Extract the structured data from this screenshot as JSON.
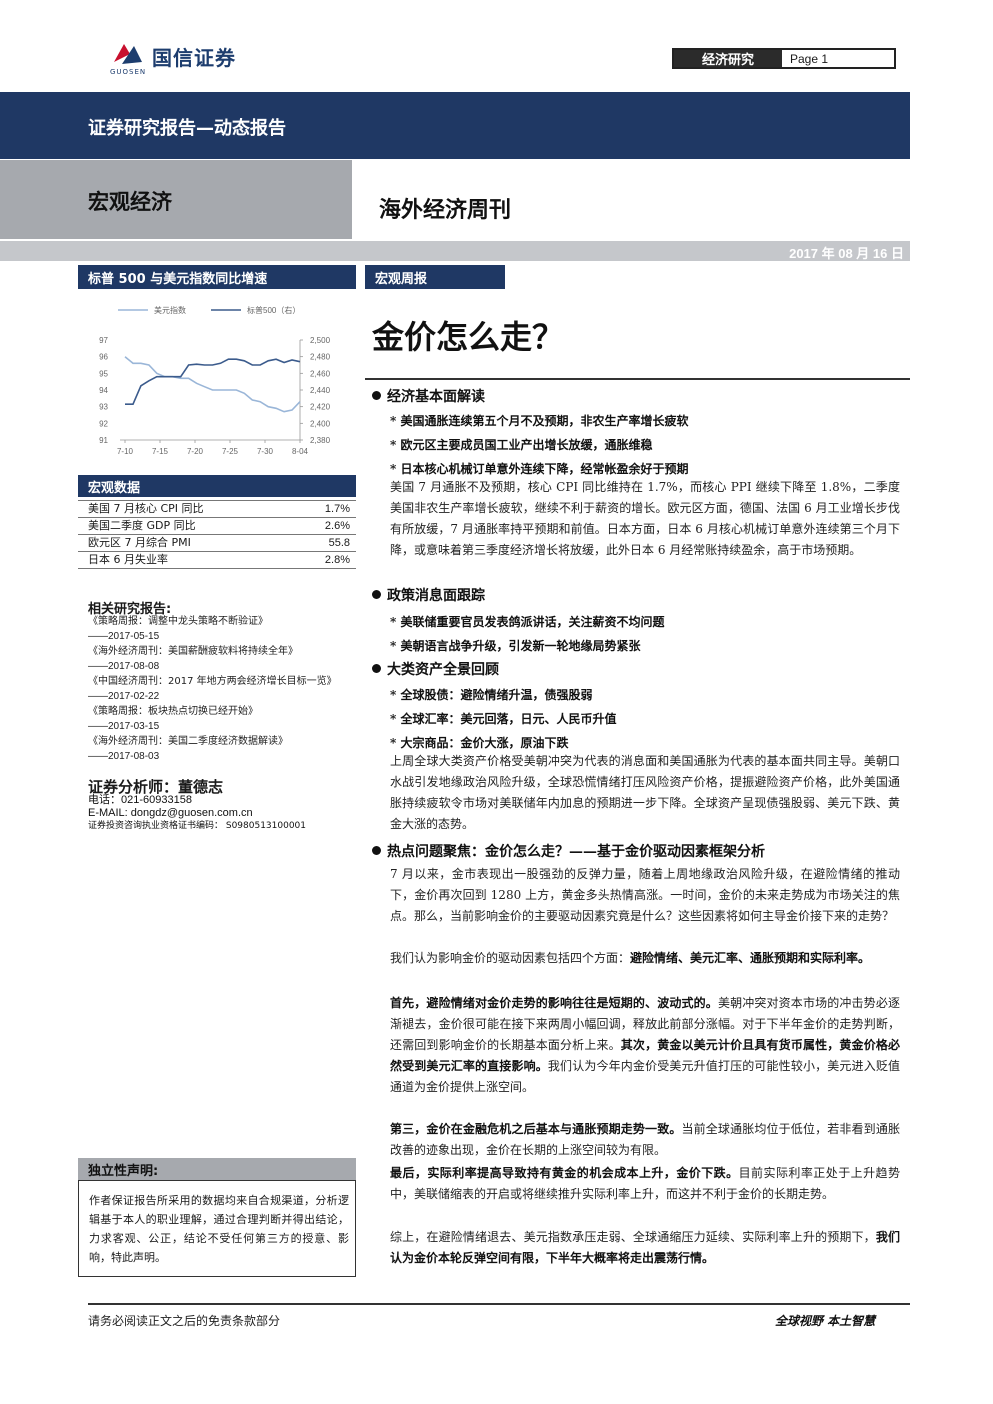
{
  "header": {
    "logo_text": "国信证券",
    "logo_sub": "GUOSEN",
    "tag": "经济研究",
    "page_label": "Page",
    "page_num": "1",
    "banner": "证券研究报告—动态报告",
    "category": "宏观经济",
    "periodical": "海外经济周刊",
    "date": "2017 年 08 月 16 日"
  },
  "sidebar": {
    "chart_title": "标普 500 与美元指数同比增速",
    "macro_title": "宏观数据",
    "macro_rows": [
      {
        "label": "美国 7 月核心 CPI 同比",
        "value": "1.7%"
      },
      {
        "label": "美国二季度 GDP 同比",
        "value": "2.6%"
      },
      {
        "label": "欧元区 7 月综合 PMI",
        "value": "55.8"
      },
      {
        "label": "日本 6 月失业率",
        "value": "2.8%"
      }
    ],
    "related_head": "相关研究报告:",
    "related": [
      {
        "title": "《策略周报：调整中龙头策略不断验证》",
        "date": "——2017-05-15"
      },
      {
        "title": "《海外经济周刊：美国薪酬疲软料将持续全年》",
        "date": "——2017-08-08"
      },
      {
        "title": "《中国经济周刊：2017 年地方两会经济增长目标一览》",
        "date": "——2017-02-22"
      },
      {
        "title": "《策略周报：板块热点切换已经开始》",
        "date": "——2017-03-15"
      },
      {
        "title": "《海外经济周刊：美国二季度经济数据解读》",
        "date": "——2017-08-03"
      }
    ],
    "analyst_head": "证券分析师：董德志",
    "phone": "电话：021-60933158",
    "email": "E-MAIL:    dongdz@guosen.com.cn",
    "license": "证券投资咨询执业资格证书编码：  S0980513100001",
    "indep_title": "独立性声明:",
    "indep_text": "作者保证报告所采用的数据均来自合规渠道，分析逻辑基于本人的职业理解，通过合理判断并得出结论，力求客观、公正，结论不受任何第三方的授意、影响，特此声明。"
  },
  "main": {
    "tag": "宏观周报",
    "title": "金价怎么走？",
    "sec1": "经济基本面解读",
    "sec1_bullets": [
      "* 美国通胀连续第五个月不及预期，非农生产率增长疲软",
      "* 欧元区主要成员国工业产出增长放缓，通胀维稳",
      "* 日本核心机械订单意外连续下降，经常帐盈余好于预期"
    ],
    "sec1_para": "美国 7 月通胀不及预期，核心 CPI 同比维持在 1.7%，而核心 PPI 继续下降至 1.8%，二季度美国非农生产率增长疲软，继续不利于薪资的增长。欧元区方面，德国、法国 6 月工业增长步伐有所放缓，7 月通胀率持平预期和前值。日本方面，日本 6 月核心机械订单意外连续第三个月下降，或意味着第三季度经济增长将放缓，此外日本 6 月经常账持续盈余，高于市场预期。",
    "sec2": "政策消息面跟踪",
    "sec2_bullets": [
      "* 美联储重要官员发表鸽派讲话，关注薪资不均问题",
      "* 美朝语言战争升级，引发新一轮地缘局势紧张"
    ],
    "sec3": "大类资产全景回顾",
    "sec3_bullets": [
      "* 全球股债：避险情绪升温，债强股弱",
      "* 全球汇率：美元回落，日元、人民币升值",
      "* 大宗商品：金价大涨，原油下跌"
    ],
    "sec3_para": "上周全球大类资产价格受美朝冲突为代表的消息面和美国通胀为代表的基本面共同主导。美朝口水战引发地缘政治风险升级，全球恐慌情绪打压风险资产价格，提振避险资产价格，此外美国通胀持续疲软令市场对美联储年内加息的预期进一步下降。全球资产呈现债强股弱、美元下跌、黄金大涨的态势。",
    "sec4": "热点问题聚焦：金价怎么走？——基于金价驱动因素框架分析",
    "p1": "7 月以来，金市表现出一股强劲的反弹力量，随着上周地缘政治风险升级，在避险情绪的推动下，金价再次回到 1280 上方，黄金多头热情高涨。一时间，金价的未来走势成为市场关注的焦点。那么，当前影响金价的主要驱动因素究竟是什么？这些因素将如何主导金价接下来的走势？",
    "p2_a": "我们认为影响金价的驱动因素包括四个方面：",
    "p2_b": "避险情绪、美元汇率、通胀预期和实际利率。",
    "p3_a": "首先，避险情绪对金价走势的影响往往是短期的、波动式的。",
    "p3_b": "美朝冲突对资本市场的冲击势必逐渐褪去，金价很可能在接下来两周小幅回调，释放此前部分涨幅。对于下半年金价的走势判断，还需回到影响金价的长期基本面分析上来。",
    "p3_c": "其次，黄金以美元计价且具有货币属性，黄金价格必然受到美元汇率的直接影响。",
    "p3_d": "我们认为今年内金价受美元升值打压的可能性较小，美元进入贬值通道为金价提供上涨空间。",
    "p4_a": "第三，金价在金融危机之后基本与通胀预期走势一致。",
    "p4_b": "当前全球通胀均位于低位，若非看到通胀改善的迹象出现，金价在长期的上涨空间较为有限。",
    "p5_a": "最后，实际利率提高导致持有黄金的机会成本上升，金价下跌。",
    "p5_b": "目前实际利率正处于上升趋势中，美联储缩表的开启或将继续推升实际利率上升，而这并不利于金价的长期走势。",
    "p6_a": "综上，在避险情绪退去、美元指数承压走弱、全球通缩压力延续、实际利率上升的预期下，",
    "p6_b": "我们认为金价本轮反弹空间有限，下半年大概率将走出震荡行情。"
  },
  "footer": {
    "left": "请务必阅读正文之后的免责条款部分",
    "right": "全球视野  本土智慧"
  },
  "chart_data": {
    "type": "line",
    "x_ticks": [
      "7-10",
      "7-15",
      "7-20",
      "7-25",
      "7-30",
      "8-04"
    ],
    "y_left_ticks": [
      91,
      92,
      93,
      94,
      95,
      96,
      97
    ],
    "y_right_ticks": [
      "2,380",
      "2,400",
      "2,420",
      "2,440",
      "2,460",
      "2,480",
      "2,500"
    ],
    "ylim_left": [
      91,
      97
    ],
    "ylim_right": [
      2380,
      2500
    ],
    "series": [
      {
        "name": "美元指数",
        "axis": "left",
        "color": "#9ab6d8",
        "values": [
          96.0,
          95.6,
          95.6,
          95.5,
          95.0,
          94.8,
          94.8,
          94.7,
          94.7,
          94.4,
          94.2,
          94.0,
          94.0,
          94.0,
          94.0,
          93.8,
          93.4,
          93.3,
          93.0,
          92.9,
          92.7,
          92.8,
          93.3
        ]
      },
      {
        "name": "标普500（右）",
        "axis": "right",
        "color": "#3b5b8c",
        "values": [
          2423,
          2423,
          2445,
          2451,
          2456,
          2456,
          2456,
          2456,
          2470,
          2471,
          2470,
          2470,
          2472,
          2477,
          2477,
          2475,
          2470,
          2470,
          2475,
          2477,
          2473,
          2476,
          2474
        ]
      }
    ],
    "legend_position": "top",
    "grid": false
  }
}
